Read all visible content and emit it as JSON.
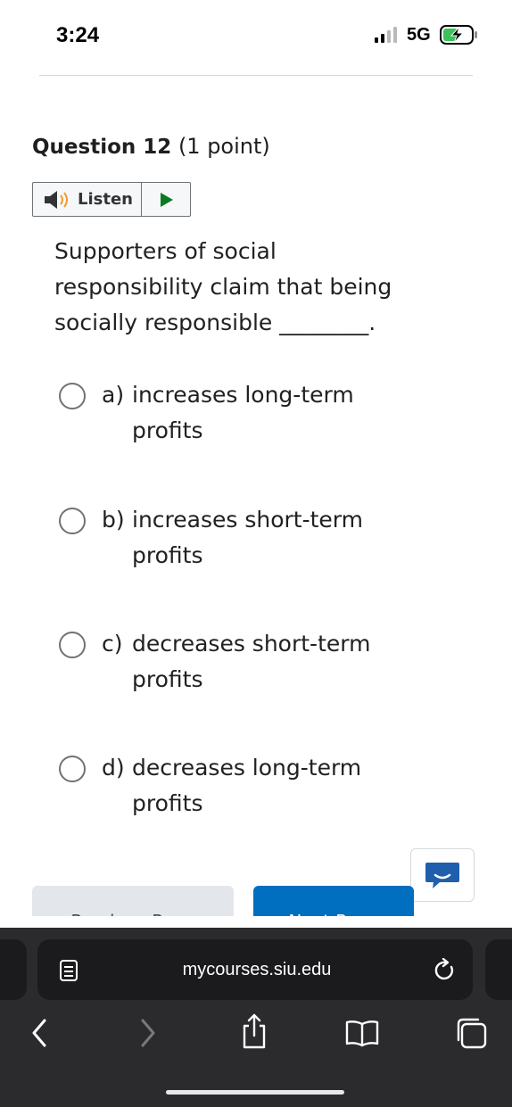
{
  "status_bar": {
    "time": "3:24",
    "network": "5G",
    "signal_bars": 2,
    "battery_icon": "battery-charging-icon"
  },
  "question": {
    "title": "Question 12",
    "points": "(1 point)",
    "listen_label": "Listen",
    "stem": "Supporters of social responsibility claim that being socially responsible ________.",
    "options": [
      {
        "letter": "a)",
        "text": "increases long-term profits"
      },
      {
        "letter": "b)",
        "text": "increases short-term profits"
      },
      {
        "letter": "c)",
        "text": "decreases short-term profits"
      },
      {
        "letter": "d)",
        "text": "decreases long-term profits"
      }
    ]
  },
  "nav": {
    "previous_label": "Previous Page",
    "next_label": "Next Page"
  },
  "browser": {
    "url": "mycourses.siu.edu"
  },
  "colors": {
    "accent": "#006fbf",
    "secondary_button": "#e3e7ec",
    "chrome_bg": "#2b2b2d"
  }
}
